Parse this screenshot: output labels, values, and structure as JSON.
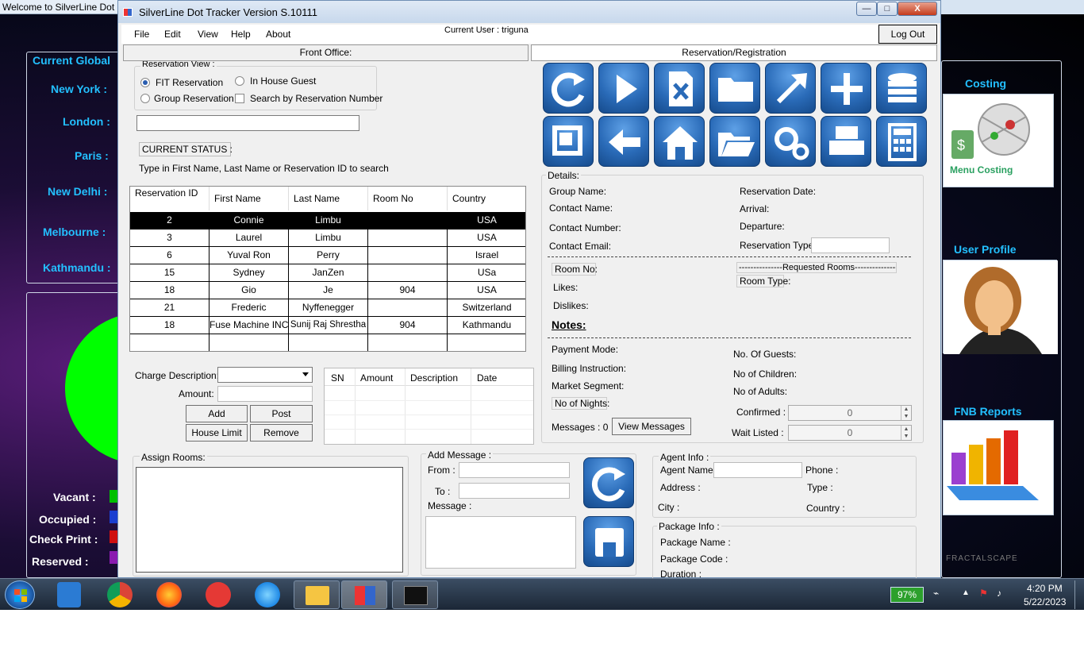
{
  "background_window": {
    "title": "Welcome to SilverLine Dot",
    "global_heading": "Current Global",
    "cities": [
      "New York :",
      "London :",
      "Paris :",
      "New Delhi :",
      "Melbourne :",
      "Kathmandu :"
    ],
    "legend": [
      {
        "label": "Vacant :",
        "color": "#00c000"
      },
      {
        "label": "Occupied :",
        "color": "#1a3fd0"
      },
      {
        "label": "Check Print :",
        "color": "#d01010"
      },
      {
        "label": "Reserved :",
        "color": "#8a1ab0"
      }
    ],
    "tiles": [
      {
        "heading": "Costing",
        "caption": "Menu Costing"
      },
      {
        "heading": "User Profile",
        "caption": ""
      },
      {
        "heading": "FNB Reports",
        "caption": ""
      }
    ],
    "watermark": "FRACTALSCAPE"
  },
  "window": {
    "title": "SilverLine Dot Tracker Version  S.10111",
    "controls": {
      "minimize": "—",
      "maximize": "□",
      "close": "X"
    }
  },
  "menu": {
    "items": [
      "File",
      "Edit",
      "View",
      "Help",
      "About"
    ],
    "current_user": "Current User : triguna",
    "logout": "Log Out"
  },
  "tabs": {
    "front_office": "Front Office:",
    "reservation": "Reservation/Registration"
  },
  "reservation_view": {
    "legend": "Reservation View :",
    "options": {
      "fit": "FIT Reservation",
      "in_house": "In House Guest",
      "group": "Group Reservation",
      "search_by_number": "Search by Reservation Number"
    },
    "selected": "FIT Reservation",
    "search_value": "",
    "current_status": "CURRENT STATUS :",
    "hint": "Type in First Name, Last Name or Reservation ID to search"
  },
  "grid": {
    "headers": [
      "Reservation ID",
      "First Name",
      "Last Name",
      "Room No",
      "Country"
    ],
    "rows": [
      [
        "2",
        "Connie",
        "Limbu",
        "",
        "USA"
      ],
      [
        "3",
        "Laurel",
        "Limbu",
        "",
        "USA"
      ],
      [
        "6",
        "Yuval Ron",
        "Perry",
        "",
        "Israel"
      ],
      [
        "15",
        "Sydney",
        "JanZen",
        "",
        "USa"
      ],
      [
        "18",
        "Gio",
        "Je",
        "904",
        "USA"
      ],
      [
        "21",
        "Frederic",
        "Nyffenegger",
        "",
        "Switzerland"
      ],
      [
        "18",
        "Fuse Machine INC",
        "Sunij Raj Shrestha",
        "904",
        "Kathmandu"
      ],
      [
        "",
        "",
        "",
        "",
        ""
      ]
    ],
    "selected_row": 0
  },
  "charges": {
    "description_label": "Charge Description:",
    "amount_label": "Amount:",
    "buttons": {
      "add": "Add",
      "post": "Post",
      "house_limit": "House Limit",
      "remove": "Remove"
    },
    "table_headers": [
      "SN",
      "Amount",
      "Description",
      "Date"
    ]
  },
  "assign_rooms": {
    "legend": "Assign Rooms:"
  },
  "add_message": {
    "legend": "Add Message :",
    "from": "From :",
    "to": "To :",
    "message": "Message :"
  },
  "toolbar_icons": [
    "refresh-icon",
    "play-icon",
    "excel-icon",
    "folder-icon",
    "arrow-icon",
    "add-icon",
    "database-icon",
    "window-icon",
    "back-icon",
    "home-icon",
    "open-folder-icon",
    "settings-icon",
    "print-icon",
    "calculator-icon"
  ],
  "details": {
    "legend": "Details:",
    "group_name": "Group Name:",
    "reservation_date": "Reservation Date:",
    "contact_name": "Contact Name:",
    "arrival": "Arrival:",
    "contact_number": "Contact Number:",
    "departure": "Departure:",
    "contact_email": "Contact Email:",
    "reservation_type": "Reservation Type:",
    "room_no": "Room No:",
    "requested_rooms": "---------------Requested Rooms---------------",
    "room_type": "Room Type:",
    "likes": "Likes:",
    "dislikes": "Dislikes:",
    "notes": "Notes:",
    "payment_mode": "Payment Mode:",
    "no_of_guests": "No. Of Guests:",
    "billing_instruction": "Billing Instruction:",
    "no_of_children": "No of Children:",
    "market_segment": "Market Segment:",
    "no_of_adults": "No of Adults:",
    "no_of_nights": "No of Nights:",
    "confirmed": "Confirmed :",
    "confirmed_value": "0",
    "wait_listed": "Wait Listed :",
    "wait_listed_value": "0",
    "messages": "Messages : 0",
    "view_messages": "View Messages"
  },
  "agent_info": {
    "legend": "Agent Info :",
    "agent_name": "Agent Name :",
    "phone": "Phone :",
    "address": "Address :",
    "type": "Type :",
    "city": "City :",
    "country": "Country :"
  },
  "package_info": {
    "legend": "Package Info :",
    "package_name": "Package Name :",
    "package_code": "Package Code :",
    "duration": "Duration :"
  },
  "taskbar": {
    "battery": "97%",
    "time": "4:20 PM",
    "date": "5/22/2023"
  }
}
